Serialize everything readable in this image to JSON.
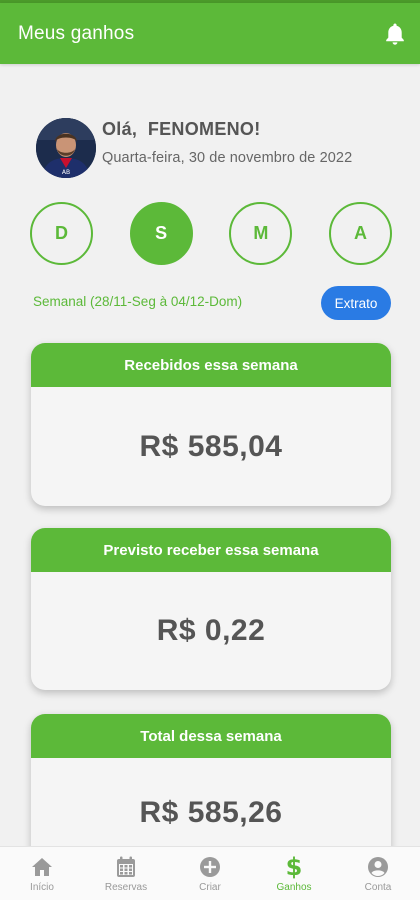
{
  "header": {
    "title": "Meus ganhos",
    "notification_icon": "bell-icon"
  },
  "profile": {
    "greeting": "Olá,",
    "name": "FENOMENO!",
    "date": "Quarta-feira, 30 de novembro de 2022"
  },
  "periods": [
    {
      "label": "D",
      "active": false
    },
    {
      "label": "S",
      "active": true
    },
    {
      "label": "M",
      "active": false
    },
    {
      "label": "A",
      "active": false
    }
  ],
  "range": {
    "text": "Semanal (28/11-Seg à 04/12-Dom)",
    "extrato_label": "Extrato"
  },
  "cards": [
    {
      "title": "Recebidos essa semana",
      "value": "R$ 585,04"
    },
    {
      "title": "Previsto receber essa semana",
      "value": "R$ 0,22"
    },
    {
      "title": "Total dessa semana",
      "value": "R$ 585,26"
    }
  ],
  "nav": [
    {
      "label": "Início",
      "icon": "home-icon",
      "active": false
    },
    {
      "label": "Reservas",
      "icon": "calendar-icon",
      "active": false
    },
    {
      "label": "Criar",
      "icon": "add-circle-icon",
      "active": false
    },
    {
      "label": "Ganhos",
      "icon": "dollar-icon",
      "active": true
    },
    {
      "label": "Conta",
      "icon": "account-icon",
      "active": false
    }
  ],
  "colors": {
    "primary": "#5cb939",
    "accent_blue": "#2a7be4",
    "text": "#555555",
    "inactive": "#999999"
  }
}
